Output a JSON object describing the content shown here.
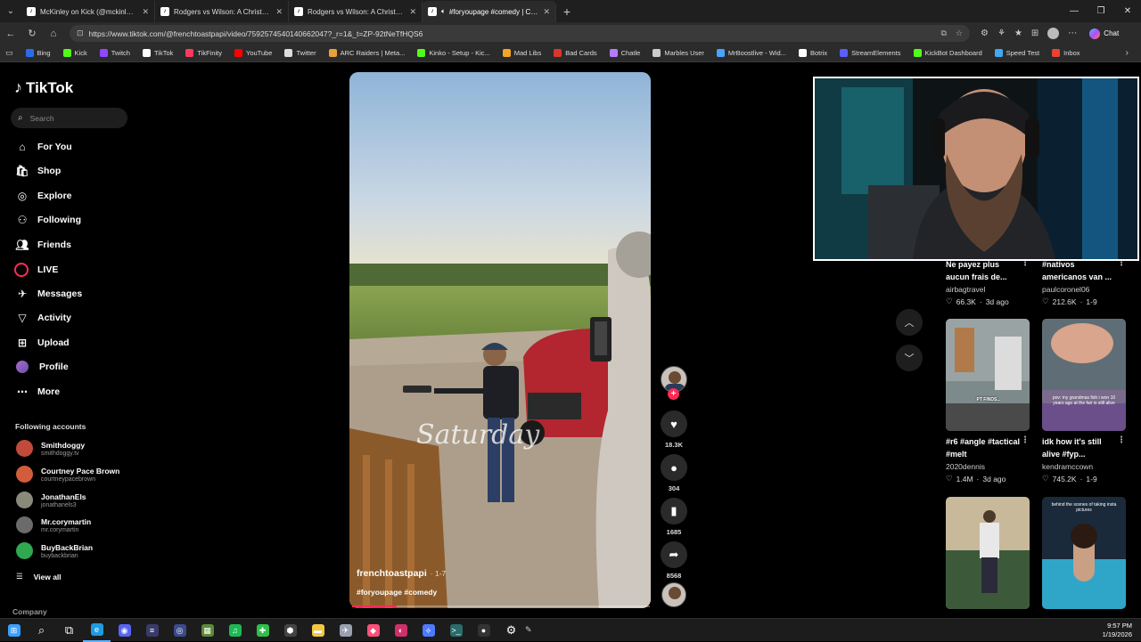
{
  "browser": {
    "tabs": [
      {
        "title": "McKinley on Kick (@mckinley.tv) |",
        "icon": "tiktok-icon",
        "active": false
      },
      {
        "title": "Rodgers vs Wilson: A Christmas Su",
        "icon": "tiktok-icon",
        "active": false
      },
      {
        "title": "Rodgers vs Wilson: A Christmas Su",
        "icon": "tiktok-icon",
        "active": false
      },
      {
        "title": "#foryoupage #comedy | Com",
        "icon": "tiktok-icon",
        "active": true
      }
    ],
    "url": "https://www.tiktok.com/@frenchtoastpapi/video/7592574540140662047?_r=1&_t=ZP-92tNeTfHQS6",
    "chat_label": "Chat",
    "bookmarks": [
      {
        "label": "Bing",
        "color": "#2a6cf0"
      },
      {
        "label": "Kick",
        "color": "#53fc18"
      },
      {
        "label": "Twitch",
        "color": "#9146ff"
      },
      {
        "label": "TikTok",
        "color": "#ffffff"
      },
      {
        "label": "TikFinity",
        "color": "#ff3b5c"
      },
      {
        "label": "YouTube",
        "color": "#ff0000"
      },
      {
        "label": "Twitter",
        "color": "#dddddd"
      },
      {
        "label": "ARC Raiders | Meta...",
        "color": "#e8a03a"
      },
      {
        "label": "Kinko - Setup - Kic...",
        "color": "#53fc18"
      },
      {
        "label": "Mad Libs",
        "color": "#f5a623"
      },
      {
        "label": "Bad Cards",
        "color": "#d9372b"
      },
      {
        "label": "Chatle",
        "color": "#b57bff"
      },
      {
        "label": "Marbles User",
        "color": "#cccccc"
      },
      {
        "label": "MrBoostlive - Wid...",
        "color": "#4aa3ff"
      },
      {
        "label": "Botrix",
        "color": "#ffffff"
      },
      {
        "label": "StreamElements",
        "color": "#5a5dff"
      },
      {
        "label": "KickBot Dashboard",
        "color": "#53fc18"
      },
      {
        "label": "Speed Test",
        "color": "#3fa9f5"
      },
      {
        "label": "Inbox",
        "color": "#e94235"
      }
    ]
  },
  "tiktok": {
    "logo": "TikTok",
    "search_placeholder": "Search",
    "nav": [
      {
        "label": "For You",
        "icon": "home-icon"
      },
      {
        "label": "Shop",
        "icon": "shop-icon"
      },
      {
        "label": "Explore",
        "icon": "compass-icon"
      },
      {
        "label": "Following",
        "icon": "following-icon"
      },
      {
        "label": "Friends",
        "icon": "friends-icon"
      },
      {
        "label": "LIVE",
        "icon": "live-icon"
      },
      {
        "label": "Messages",
        "icon": "messages-icon"
      },
      {
        "label": "Activity",
        "icon": "activity-icon"
      },
      {
        "label": "Upload",
        "icon": "upload-icon"
      },
      {
        "label": "Profile",
        "icon": "profile-icon"
      },
      {
        "label": "More",
        "icon": "more-icon"
      }
    ],
    "following_label": "Following accounts",
    "following_accounts": [
      {
        "name": "Smithdoggy",
        "handle": "smithdoggy.tv",
        "color": "#c24a3a"
      },
      {
        "name": "Courtney Pace Brown",
        "handle": "courtneypacebrown",
        "color": "#d35d3a"
      },
      {
        "name": "JonathanEls",
        "handle": "jonathanels3",
        "color": "#8a8a7a"
      },
      {
        "name": "Mr.corymartin",
        "handle": "mr.corymartin",
        "color": "#6b6b6b"
      },
      {
        "name": "BuyBackBrian",
        "handle": "buybackbrian",
        "color": "#2fa84f"
      }
    ],
    "view_all": "View all",
    "company": "Company"
  },
  "video": {
    "username": "frenchtoastpapi",
    "time_ago": "· 1-7",
    "hashtags": "#foryoupage #comedy",
    "overlay_text": "Saturday",
    "progress": 0.15,
    "likes": "18.3K",
    "comments": "304",
    "saves": "1685",
    "shares": "8568"
  },
  "recommendations": [
    {
      "title": "Ne payez plus aucun frais de...",
      "user": "airbagtravel",
      "likes": "66.3K",
      "date": "3d ago"
    },
    {
      "title": "#nativos americanos van ...",
      "user": "paulcoronel06",
      "likes": "212.6K",
      "date": "1-9"
    },
    {
      "title": "#r6 #angle #tactical #melt",
      "user": "2020dennis",
      "likes": "1.4M",
      "date": "3d ago",
      "thumb_color": "#7d8a8c"
    },
    {
      "title": "idk how it's still alive #fyp...",
      "user": "kendramccown",
      "likes": "745.2K",
      "date": "1-9",
      "thumb_color": "#7a6b8c",
      "thumb_text": "pov: my grandmas fish i won 10 years ago at the fair is still alive"
    },
    {
      "title": "",
      "user": "",
      "likes": "",
      "date": "",
      "thumb_color": "#c7b99a"
    },
    {
      "title": "",
      "user": "",
      "likes": "",
      "date": "",
      "thumb_color": "#1b2a3a",
      "thumb_text": "behind the scenes of taking insta pictures"
    }
  ],
  "taskbar": {
    "time": "9:57 PM",
    "date": "1/19/2026",
    "apps": [
      {
        "name": "start-button",
        "color": "#3aa0ff",
        "glyph": "⊞"
      },
      {
        "name": "search-icon",
        "color": "transparent",
        "glyph": "⌕"
      },
      {
        "name": "task-view-icon",
        "color": "transparent",
        "glyph": "⧉"
      },
      {
        "name": "edge-icon",
        "color": "#1f9be0",
        "glyph": "e"
      },
      {
        "name": "discord-icon",
        "color": "#5865f2",
        "glyph": "◉"
      },
      {
        "name": "app-icon-1",
        "color": "#3a3a6a",
        "glyph": "≡"
      },
      {
        "name": "app-icon-2",
        "color": "#3a4a8a",
        "glyph": "◎"
      },
      {
        "name": "minecraft-icon",
        "color": "#5b8a3a",
        "glyph": "▦"
      },
      {
        "name": "spotify-icon",
        "color": "#1db954",
        "glyph": "♫"
      },
      {
        "name": "app-icon-3",
        "color": "#2fbf4a",
        "glyph": "✚"
      },
      {
        "name": "app-icon-4",
        "color": "#444444",
        "glyph": "⬢"
      },
      {
        "name": "file-explorer-icon",
        "color": "#f2c744",
        "glyph": "▬"
      },
      {
        "name": "app-icon-5",
        "color": "#9aa0b0",
        "glyph": "✈"
      },
      {
        "name": "app-icon-6",
        "color": "#ff4f7a",
        "glyph": "◆"
      },
      {
        "name": "app-icon-7",
        "color": "#d0306a",
        "glyph": "◐"
      },
      {
        "name": "app-icon-8",
        "color": "#4b7bff",
        "glyph": "⟡"
      },
      {
        "name": "terminal-icon",
        "color": "#2a6b6b",
        "glyph": ">_"
      },
      {
        "name": "obs-icon",
        "color": "#333333",
        "glyph": "●"
      },
      {
        "name": "settings-icon",
        "color": "transparent",
        "glyph": "⚙"
      }
    ]
  }
}
